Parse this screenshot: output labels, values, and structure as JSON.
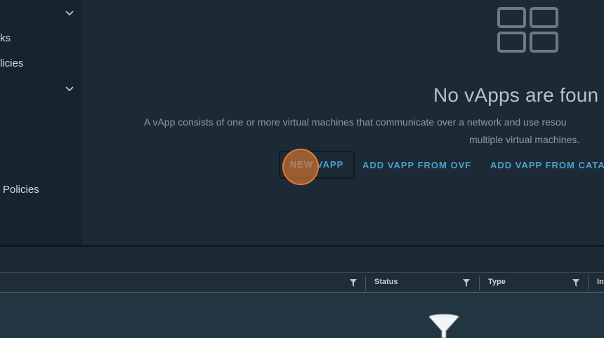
{
  "sidebar": {
    "items": [
      {
        "label": "ks"
      },
      {
        "label": "licies"
      },
      {
        "label": "Policies"
      }
    ]
  },
  "empty_state": {
    "icon": "grid-icon",
    "title": "No vApps are foun",
    "description_line1": "A vApp consists of one or more virtual machines that communicate over a network and use resou",
    "description_line2": "multiple virtual machines."
  },
  "actions": {
    "new_vapp": "NEW VAPP",
    "add_from_ovf": "ADD VAPP FROM OVF",
    "add_from_catalog": "ADD VAPP FROM CATA"
  },
  "table": {
    "columns": [
      {
        "label": ""
      },
      {
        "label": "Status"
      },
      {
        "label": "Type"
      },
      {
        "label": "In"
      }
    ],
    "empty_icon": "funnel-icon"
  },
  "colors": {
    "accent": "#4ea0c9",
    "background": "#1c2a35",
    "cursor": "#e07a33"
  }
}
